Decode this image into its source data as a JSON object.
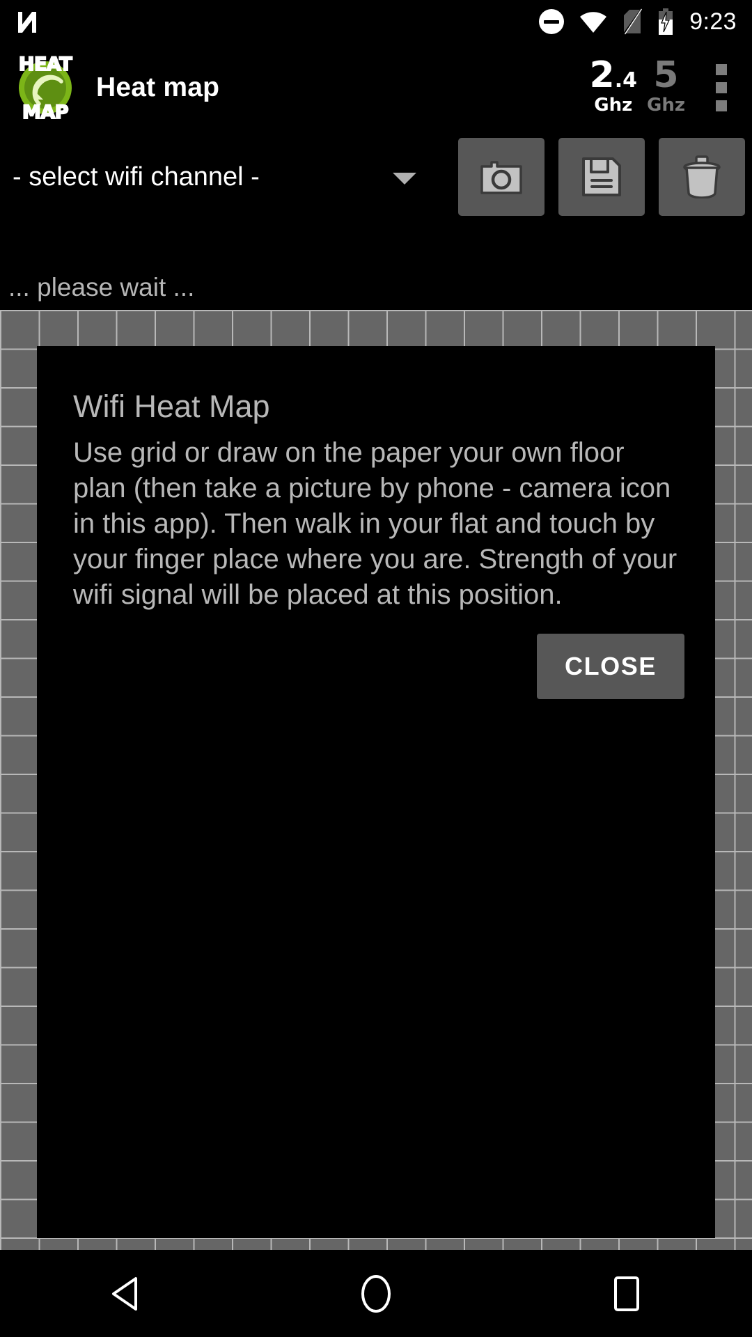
{
  "statusbar": {
    "nfc_icon": "nfc-icon",
    "dnd_icon": "do-not-disturb-icon",
    "wifi_icon": "wifi-icon",
    "sim_icon": "no-sim-icon",
    "battery_icon": "battery-charging-icon",
    "time": "9:23"
  },
  "appbar": {
    "logo_top_text": "HEAT",
    "logo_bottom_text": "MAP",
    "logo_icon": "wifi-heatmap-logo",
    "title": "Heat map",
    "bands": [
      {
        "value": "2",
        "decimal": ".4",
        "unit": "Ghz",
        "active": true
      },
      {
        "value": "5",
        "decimal": "",
        "unit": "Ghz",
        "active": false
      }
    ],
    "overflow_label": "more-options"
  },
  "channel_row": {
    "spinner_value": "- select wifi channel -",
    "buttons": [
      {
        "name": "camera-button",
        "icon": "camera-icon"
      },
      {
        "name": "save-button",
        "icon": "floppy-disk-icon"
      },
      {
        "name": "delete-button",
        "icon": "trash-icon"
      }
    ]
  },
  "status_line": {
    "text": "... please wait ..."
  },
  "dialog": {
    "title": "Wifi Heat Map",
    "body": "Use grid or draw on the paper your own floor plan (then take a picture by phone - camera icon in this app). Then walk in your flat and touch by your finger place where you are. Strength of your wifi signal will be placed at this position.",
    "close_label": "CLOSE"
  },
  "navbar": {
    "back_label": "back-icon",
    "home_label": "home-icon",
    "recents_label": "recents-icon"
  },
  "colors": {
    "brand_green": "#7cb518",
    "grid_fill": "#666666",
    "grid_line": "#b8b8b8",
    "button_gray": "#575757",
    "text_gray": "#b8b8b8",
    "accent_white": "#ffffff",
    "inactive_gray": "#7a7a7a"
  }
}
